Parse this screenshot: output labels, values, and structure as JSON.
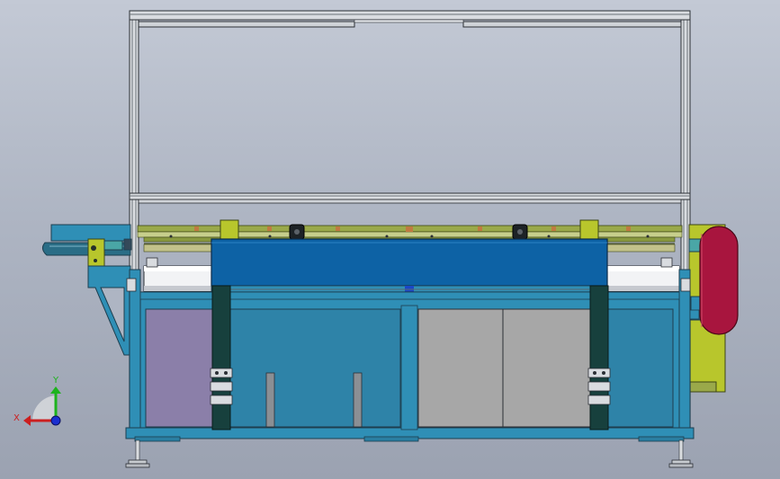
{
  "view": {
    "title": "",
    "background_top": "#c3c9d5",
    "background_bottom": "#9ba2b1"
  },
  "colors": {
    "frame_blue": "#2f8fb6",
    "frame_outline": "#1d3e4f",
    "top_hood": "#0d62a5",
    "panel_purple": "#8b7fa9",
    "panel_teal": "#2e83a8",
    "panel_gray": "#a7a7a7",
    "post_dark": "#17403d",
    "rail_olive": "#9aa94a",
    "olive_block": "#b8c62c",
    "roller_white": "#f2f3f5",
    "red_roller": "#a8153e",
    "teal_block": "#4aa6a6",
    "conveyor_dark": "#2f6e86",
    "aluminum": "#d9dce0"
  },
  "triad": {
    "y_label": "Y",
    "x_label": "X",
    "y_color": "#1db31d",
    "x_color": "#cc1f1f",
    "z_color": "#1a2fd0"
  }
}
